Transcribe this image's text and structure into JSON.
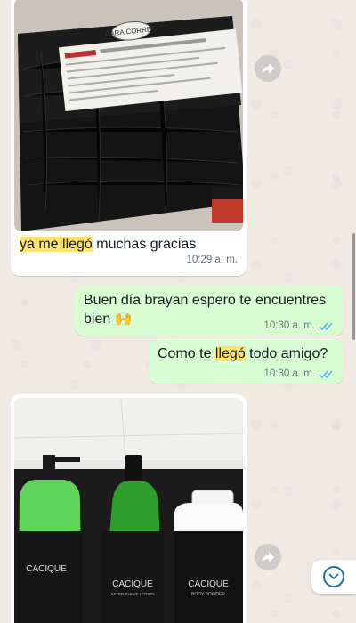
{
  "messages": [
    {
      "direction": "incoming",
      "type": "image",
      "image_subject": "package-wrapped-in-black-plastic-with-label",
      "label_text": "PARA CORREO",
      "caption_parts": [
        "ya me llegó",
        " muchas gracias"
      ],
      "time": "10:29 a. m."
    },
    {
      "direction": "outgoing",
      "type": "text",
      "text_line1": "Buen día brayan espero te encuentres",
      "text_line2": "bien",
      "emoji": "🙌",
      "time": "10:30 a. m.",
      "status": "read"
    },
    {
      "direction": "outgoing",
      "type": "text",
      "text_parts": [
        "Como te ",
        "llegó",
        " todo amigo?"
      ],
      "time": "10:30 a. m.",
      "status": "read"
    },
    {
      "direction": "incoming",
      "type": "image",
      "image_subject": "cacique-products-bottles",
      "product_labels": [
        "CACIQUE",
        "CACIQUE",
        "CACIQUE"
      ],
      "product_subtitles": [
        "",
        "AFTER SHAVE LOTION",
        "BODY POWDER"
      ]
    }
  ],
  "icons": {
    "forward": "forward-arrow-icon",
    "scroll_down": "chevron-down-icon",
    "read_ticks": "double-check-icon"
  },
  "colors": {
    "chat_bg": "#efeae2",
    "incoming": "#ffffff",
    "outgoing": "#d9fdd3",
    "highlight": "#ffe36b",
    "read_tick": "#53bdeb"
  }
}
